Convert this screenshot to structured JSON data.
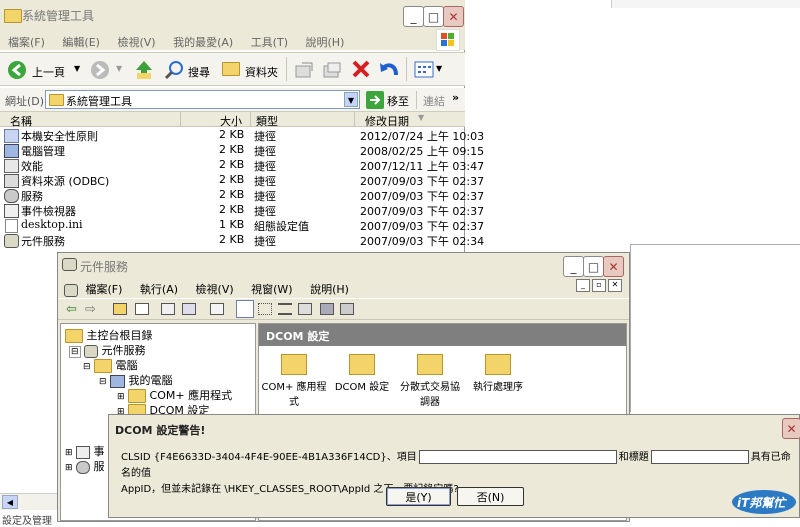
{
  "explorer": {
    "title": "系統管理工具",
    "menu": [
      "檔案(F)",
      "編輯(E)",
      "檢視(V)",
      "我的最愛(A)",
      "工具(T)",
      "說明(H)"
    ],
    "toolbar": {
      "back": "上一頁",
      "search": "搜尋",
      "folders": "資料夾"
    },
    "address": {
      "label": "網址(D)",
      "value": "系統管理工具",
      "go": "移至",
      "links": "連結"
    },
    "columns": {
      "name": "名稱",
      "size": "大小",
      "type": "類型",
      "modified": "修改日期"
    },
    "files": [
      {
        "name": "本機安全性原則",
        "size": "2 KB",
        "type": "捷徑",
        "modified": "2012/07/24 上午 10:03"
      },
      {
        "name": "電腦管理",
        "size": "2 KB",
        "type": "捷徑",
        "modified": "2008/02/25 上午 09:15"
      },
      {
        "name": "效能",
        "size": "2 KB",
        "type": "捷徑",
        "modified": "2007/12/11 上午 03:47"
      },
      {
        "name": "資料來源 (ODBC)",
        "size": "2 KB",
        "type": "捷徑",
        "modified": "2007/09/03 下午 02:37"
      },
      {
        "name": "服務",
        "size": "2 KB",
        "type": "捷徑",
        "modified": "2007/09/03 下午 02:37"
      },
      {
        "name": "事件檢視器",
        "size": "2 KB",
        "type": "捷徑",
        "modified": "2007/09/03 下午 02:37"
      },
      {
        "name": "desktop.ini",
        "size": "1 KB",
        "type": "組態設定值",
        "modified": "2007/09/03 下午 02:37"
      },
      {
        "name": "元件服務",
        "size": "2 KB",
        "type": "捷徑",
        "modified": "2007/09/03 下午 02:34"
      }
    ]
  },
  "component": {
    "title": "元件服務",
    "menu": [
      "檔案(F)",
      "執行(A)",
      "檢視(V)",
      "視窗(W)",
      "說明(H)"
    ],
    "tree": {
      "root": "主控台根目錄",
      "services": "元件服務",
      "computers": "電腦",
      "mycomputer": "我的電腦",
      "complus": "COM+ 應用程式",
      "dcom": "DCOM 設定",
      "partial1": "事",
      "partial2": "服"
    },
    "pane_title": "DCOM 設定",
    "icons": [
      "COM+ 應用程式",
      "DCOM 設定",
      "分散式交易協調器",
      "執行處理序"
    ]
  },
  "dialog": {
    "title": "DCOM 設定警告!",
    "line1a": "CLSID {F4E6633D-3404-4F4E-90EE-4B1A336F14CD}、項目",
    "line1b": "和標題",
    "line1c": "具有已命名的值",
    "line2": "AppID，但並未記錄在 \\HKEY_CLASSES_ROOT\\AppId 之下。要記錄它嗎?",
    "yes": "是(Y)",
    "no": "否(N)"
  },
  "bottom_left_text": "設定及管理",
  "watermark": "iT邦幫忙"
}
